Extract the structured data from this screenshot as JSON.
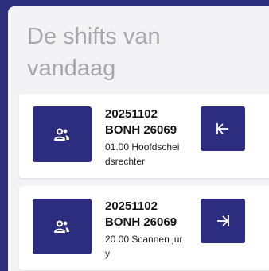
{
  "page": {
    "title": "De shifts van vandaag",
    "colors": {
      "background": "#2c2e7c",
      "panel": "#f3f3f5",
      "button": "#2d2d80",
      "title_text": "#a7a7ad"
    }
  },
  "shifts": [
    {
      "date": "20251102",
      "code": "BONH 26069",
      "description": "01.00 Hoofdscheidsrechter",
      "person_icon": "people-icon",
      "action_icon": "arrow-left-to-bar-icon"
    },
    {
      "date": "20251102",
      "code": "BONH 26069",
      "description": "20.00 Scannen jury",
      "person_icon": "people-icon",
      "action_icon": "arrow-right-to-bar-icon"
    }
  ]
}
